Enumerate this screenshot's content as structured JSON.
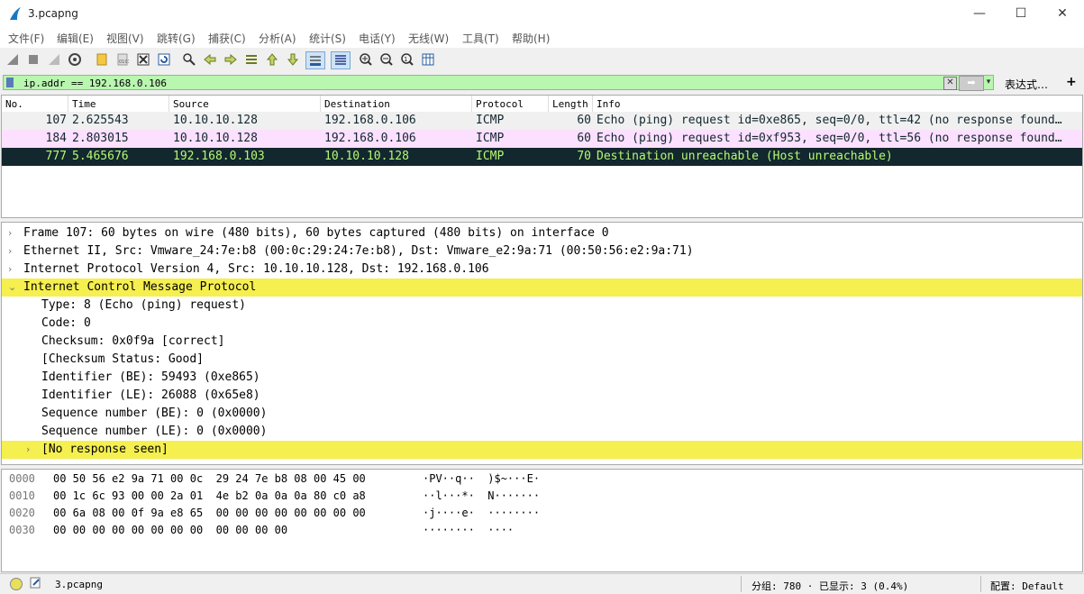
{
  "window": {
    "title": "3.pcapng",
    "controls": {
      "minimize": "—",
      "maximize": "☐",
      "close": "✕"
    }
  },
  "menu": [
    "文件(F)",
    "编辑(E)",
    "视图(V)",
    "跳转(G)",
    "捕获(C)",
    "分析(A)",
    "统计(S)",
    "电话(Y)",
    "无线(W)",
    "工具(T)",
    "帮助(H)"
  ],
  "toolbar": {
    "icons": [
      "start-capture-icon",
      "stop-capture-icon",
      "restart-capture-icon",
      "capture-options-icon",
      "open-file-icon",
      "save-file-icon",
      "close-file-icon",
      "reload-file-icon",
      "find-packet-icon",
      "go-back-icon",
      "go-forward-icon",
      "go-to-packet-icon",
      "go-first-icon",
      "go-last-icon",
      "autoscroll-icon",
      "colorize-icon",
      "zoom-in-icon",
      "zoom-out-icon",
      "zoom-normal-icon",
      "resize-columns-icon"
    ]
  },
  "filter": {
    "value": "ip.addr == 192.168.0.106",
    "expression_label": "表达式…",
    "add_label": "+",
    "clear_label": "✕",
    "apply_label": "➡",
    "dropdown_label": "▾",
    "bg_color": "#b9f6b0"
  },
  "packet_list": {
    "columns": [
      "No.",
      "Time",
      "Source",
      "Destination",
      "Protocol",
      "Length",
      "Info"
    ],
    "rows": [
      {
        "no": "107",
        "time": "2.625543",
        "source": "10.10.10.128",
        "destination": "192.168.0.106",
        "protocol": "ICMP",
        "length": "60",
        "info": "Echo (ping) request  id=0xe865, seq=0/0, ttl=42 (no response found…",
        "bg": "#f0f0f0",
        "fg": "#12272e"
      },
      {
        "no": "184",
        "time": "2.803015",
        "source": "10.10.10.128",
        "destination": "192.168.0.106",
        "protocol": "ICMP",
        "length": "60",
        "info": "Echo (ping) request  id=0xf953, seq=0/0, ttl=56 (no response found…",
        "bg": "#fce0ff",
        "fg": "#12272e"
      },
      {
        "no": "777",
        "time": "5.465676",
        "source": "192.168.0.103",
        "destination": "10.10.10.128",
        "protocol": "ICMP",
        "length": "70",
        "info": "Destination unreachable (Host unreachable)",
        "bg": "#12272e",
        "fg": "#b7f774"
      }
    ]
  },
  "details": [
    {
      "text": "Frame 107: 60 bytes on wire (480 bits), 60 bytes captured (480 bits) on interface 0",
      "indent": 0,
      "arrow": "›",
      "highlight": false
    },
    {
      "text": "Ethernet II, Src: Vmware_24:7e:b8 (00:0c:29:24:7e:b8), Dst: Vmware_e2:9a:71 (00:50:56:e2:9a:71)",
      "indent": 0,
      "arrow": "›",
      "highlight": false
    },
    {
      "text": "Internet Protocol Version 4, Src: 10.10.10.128, Dst: 192.168.0.106",
      "indent": 0,
      "arrow": "›",
      "highlight": false
    },
    {
      "text": "Internet Control Message Protocol",
      "indent": 0,
      "arrow": "⌄",
      "highlight": true
    },
    {
      "text": "Type: 8 (Echo (ping) request)",
      "indent": 1,
      "arrow": "",
      "highlight": false
    },
    {
      "text": "Code: 0",
      "indent": 1,
      "arrow": "",
      "highlight": false
    },
    {
      "text": "Checksum: 0x0f9a [correct]",
      "indent": 1,
      "arrow": "",
      "highlight": false
    },
    {
      "text": "[Checksum Status: Good]",
      "indent": 1,
      "arrow": "",
      "highlight": false
    },
    {
      "text": "Identifier (BE): 59493 (0xe865)",
      "indent": 1,
      "arrow": "",
      "highlight": false
    },
    {
      "text": "Identifier (LE): 26088 (0x65e8)",
      "indent": 1,
      "arrow": "",
      "highlight": false
    },
    {
      "text": "Sequence number (BE): 0 (0x0000)",
      "indent": 1,
      "arrow": "",
      "highlight": false
    },
    {
      "text": "Sequence number (LE): 0 (0x0000)",
      "indent": 1,
      "arrow": "",
      "highlight": false
    },
    {
      "text": "[No response seen]",
      "indent": 1,
      "arrow": "›",
      "highlight": true
    }
  ],
  "bytes": [
    {
      "offset": "0000",
      "hex": "00 50 56 e2 9a 71 00 0c  29 24 7e b8 08 00 45 00",
      "ascii": "·PV··q··  )$~···E·"
    },
    {
      "offset": "0010",
      "hex": "00 1c 6c 93 00 00 2a 01  4e b2 0a 0a 0a 80 c0 a8",
      "ascii": "··l···*·  N·······"
    },
    {
      "offset": "0020",
      "hex": "00 6a 08 00 0f 9a e8 65  00 00 00 00 00 00 00 00",
      "ascii": "·j····e·  ········"
    },
    {
      "offset": "0030",
      "hex": "00 00 00 00 00 00 00 00  00 00 00 00",
      "ascii": "········  ····"
    }
  ],
  "status": {
    "file": "3.pcapng",
    "stats": "分组: 780 · 已显示: 3 (0.4%)",
    "profile": "配置: Default"
  }
}
